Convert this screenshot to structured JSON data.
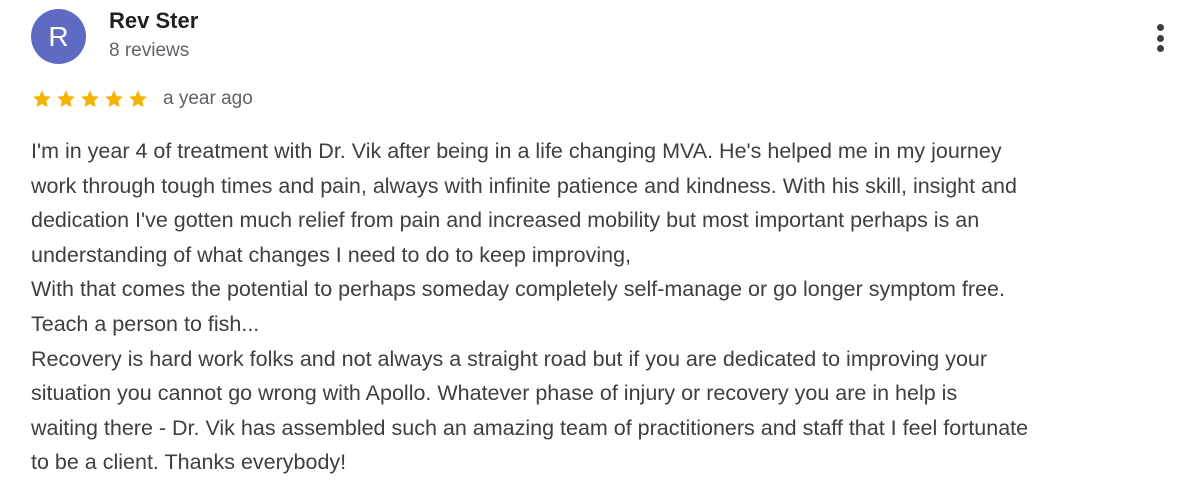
{
  "reviewer": {
    "initial": "R",
    "name": "Rev Ster",
    "review_count": "8 reviews",
    "avatar_color": "#5f6bc2"
  },
  "review": {
    "rating": 5,
    "max_rating": 5,
    "star_color": "#f4b400",
    "date": "a year ago",
    "lines": [
      "I'm in year 4 of treatment with Dr. Vik after being in a life changing MVA. He's helped me in my journey",
      "work through tough times and pain, always with infinite patience and kindness. With his skill, insight and",
      "dedication I've gotten much relief from pain and increased mobility but most important perhaps is an",
      "understanding of what changes I need to do to keep improving,",
      "With that comes the potential to perhaps someday completely self-manage or go longer symptom free.",
      "Teach a person to fish...",
      "Recovery is hard work folks and not always a straight road but if you are dedicated to improving your",
      "situation you cannot go wrong with Apollo. Whatever phase of injury or recovery you are in help is",
      "waiting there - Dr. Vik has assembled such an amazing team of practitioners and staff that I feel fortunate",
      "to be a client. Thanks everybody!"
    ]
  },
  "icons": {
    "more": "more-vert-icon",
    "star": "star-icon"
  }
}
